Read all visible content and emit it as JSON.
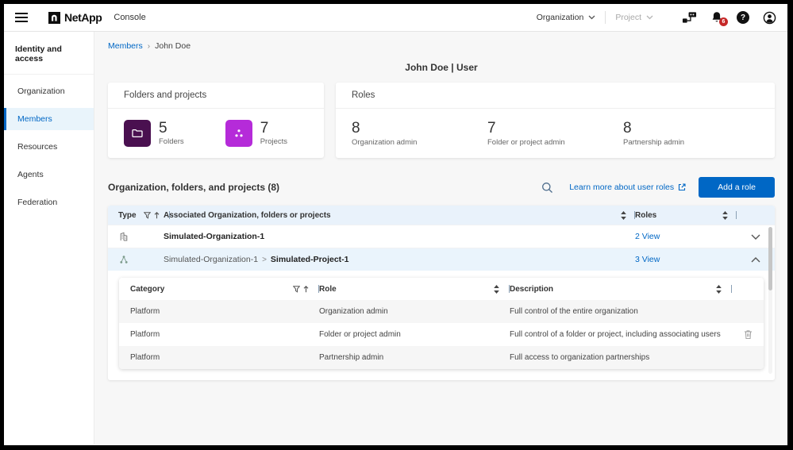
{
  "colors": {
    "accent": "#0067C5",
    "folder_tile": "#4A1050",
    "project_tile": "#B52BD9",
    "badge": "#C62828",
    "table_header_bg": "#E9F2FB",
    "selected_row_bg": "#EAF4FC"
  },
  "topbar": {
    "brand": "NetApp",
    "app_name": "Console",
    "organization_label": "Organization",
    "project_label": "Project",
    "notification_count": "6",
    "icons": [
      "hamburger-icon",
      "netapp-logo-icon",
      "connector-icon",
      "notifications-bell-icon",
      "help-icon",
      "user-avatar-icon"
    ]
  },
  "sidebar": {
    "section_header": "Identity and access",
    "items": [
      {
        "label": "Organization",
        "active": false
      },
      {
        "label": "Members",
        "active": true
      },
      {
        "label": "Resources",
        "active": false
      },
      {
        "label": "Agents",
        "active": false
      },
      {
        "label": "Federation",
        "active": false
      }
    ]
  },
  "breadcrumb": {
    "parent": "Members",
    "separator": "›",
    "current": "John Doe"
  },
  "page_title": "John Doe | User",
  "cards": {
    "folders_projects": {
      "title": "Folders and projects",
      "stats": [
        {
          "value": "5",
          "label": "Folders",
          "icon": "folder-icon"
        },
        {
          "value": "7",
          "label": "Projects",
          "icon": "projects-icon"
        }
      ]
    },
    "roles": {
      "title": "Roles",
      "stats": [
        {
          "value": "8",
          "label": "Organization admin"
        },
        {
          "value": "7",
          "label": "Folder or project admin"
        },
        {
          "value": "8",
          "label": "Partnership admin"
        }
      ]
    }
  },
  "section": {
    "title": "Organization, folders, and projects (8)",
    "learn_more_link": "Learn more about user roles",
    "add_role_button": "Add a role"
  },
  "roles_table": {
    "columns": {
      "type": "Type",
      "associated": "Associated Organization, folders or projects",
      "roles": "Roles"
    },
    "rows": [
      {
        "type_icon": "organization-icon",
        "name": "Simulated-Organization-1",
        "roles_link": "2 View",
        "expanded": false
      },
      {
        "type_icon": "project-icon",
        "path_prefix": "Simulated-Organization-1",
        "path_separator": ">",
        "name": "Simulated-Project-1",
        "roles_link": "3 View",
        "expanded": true
      }
    ]
  },
  "nested_table": {
    "columns": {
      "category": "Category",
      "role": "Role",
      "description": "Description"
    },
    "rows": [
      {
        "category": "Platform",
        "role": "Organization admin",
        "description": "Full control of the entire organization",
        "has_delete": false
      },
      {
        "category": "Platform",
        "role": "Folder or project admin",
        "description": "Full control of a folder or project, including associating users",
        "has_delete": true
      },
      {
        "category": "Platform",
        "role": "Partnership admin",
        "description": "Full access to organization partnerships",
        "has_delete": false
      }
    ]
  }
}
